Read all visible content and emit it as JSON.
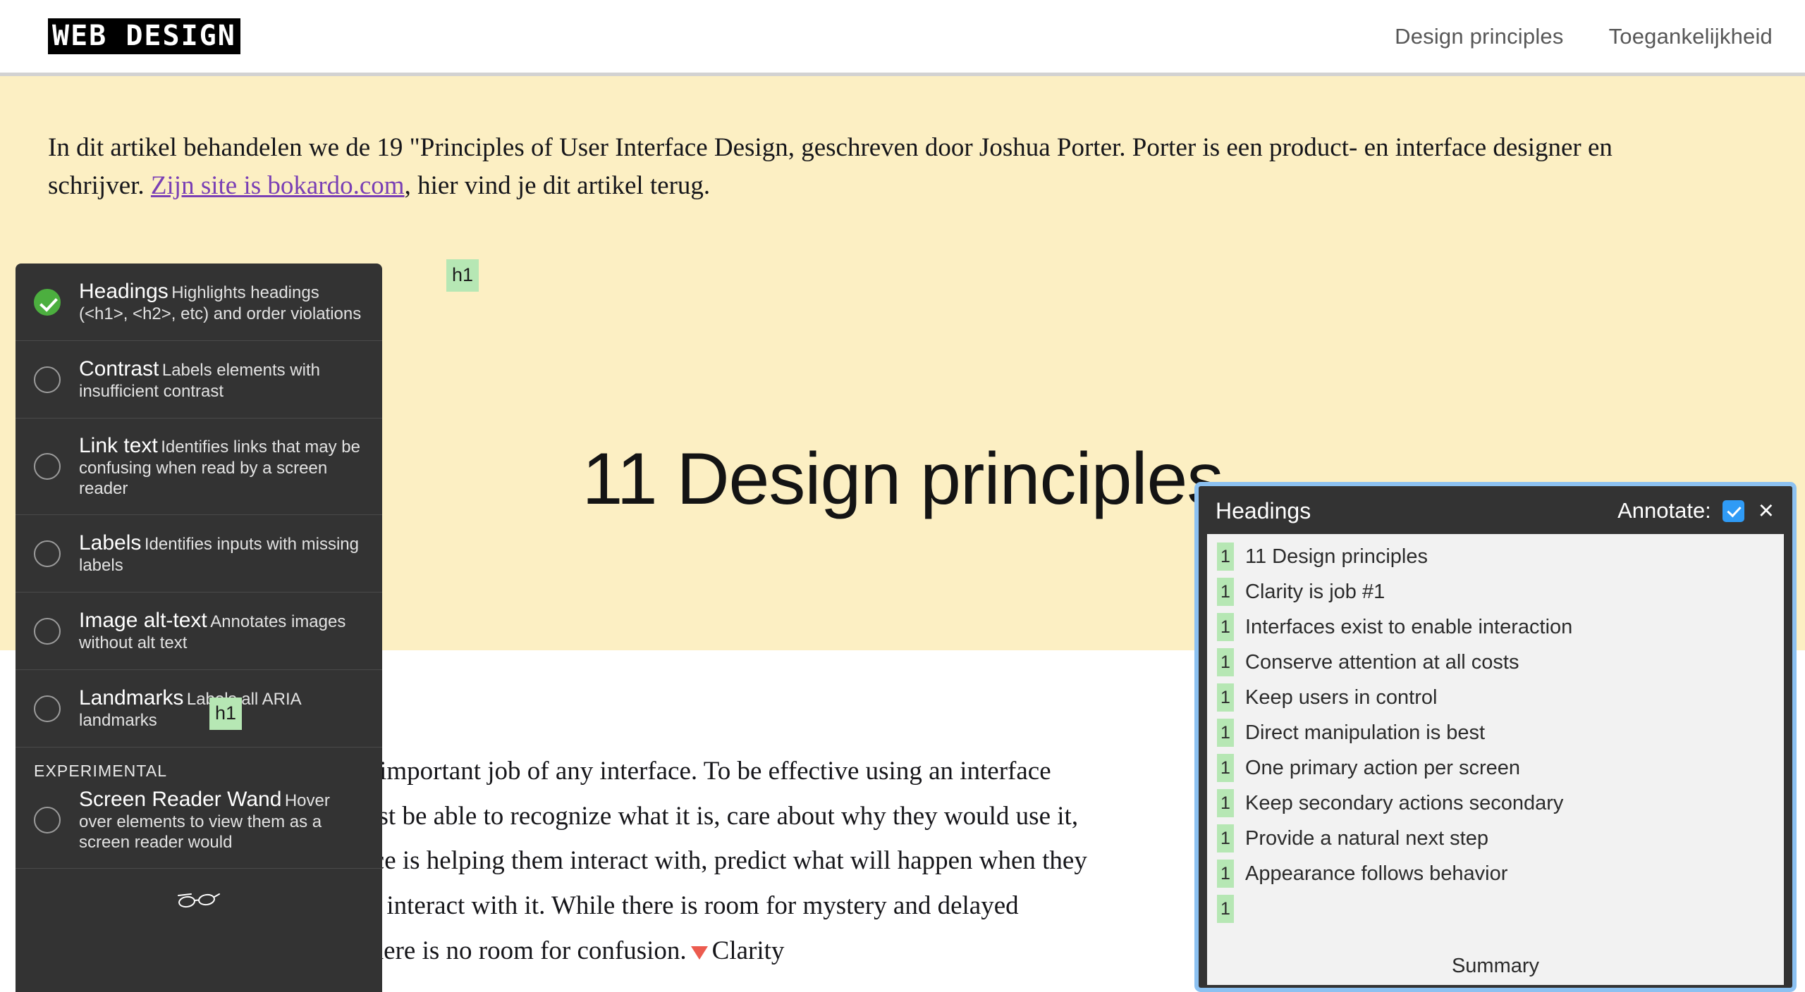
{
  "header": {
    "logo_text": "WEB DESIGN",
    "nav": [
      {
        "label": "Design principles"
      },
      {
        "label": "Toegankelijkheid"
      }
    ]
  },
  "hero": {
    "intro_before_link": "In dit artikel behandelen we de 19 \"Principles of User Interface Design, geschreven door Joshua Porter. Porter is een product- en interface designer en schrijver. ",
    "intro_link": "Zijn site is bokardo.com",
    "intro_after_link": ", hier vind je dit artikel terug.",
    "page_title": "11 Design principles",
    "badge_h1": "h1"
  },
  "content": {
    "sub_heading": "Clarity is job #1",
    "body_paragraph_a": "Clarity is the first and most important job of any interface. To be effective using an interface you've designed, people must be able to recognize what it is, care about why they would use it, understand what the interface is helping them interact with, predict what will happen when they use it, and then successfully interact with it. While there is room for mystery and delayed gratification in interfaces, there is no room for confusion.",
    "body_paragraph_b": "Clarity",
    "badge_h1": "h1"
  },
  "tool_panel": {
    "items": [
      {
        "title": "Headings",
        "desc": "Highlights headings (<h1>, <h2>, etc) and order violations",
        "enabled": true
      },
      {
        "title": "Contrast",
        "desc": "Labels elements with insufficient contrast",
        "enabled": false
      },
      {
        "title": "Link text",
        "desc": "Identifies links that may be confusing when read by a screen reader",
        "enabled": false
      },
      {
        "title": "Labels",
        "desc": "Identifies inputs with missing labels",
        "enabled": false
      },
      {
        "title": "Image alt-text",
        "desc": "Annotates images without alt text",
        "enabled": false
      },
      {
        "title": "Landmarks",
        "desc": "Labels all ARIA landmarks",
        "enabled": false
      }
    ],
    "experimental_label": "EXPERIMENTAL",
    "experimental_items": [
      {
        "title": "Screen Reader Wand",
        "desc": "Hover over elements to view them as a screen reader would",
        "enabled": false
      }
    ],
    "footer_icon": "glasses-icon"
  },
  "headings_panel": {
    "title": "Headings",
    "annotate_label": "Annotate:",
    "annotate_checked": true,
    "close_label": "×",
    "summary_label": "Summary",
    "items": [
      {
        "level": "1",
        "label": "11 Design principles"
      },
      {
        "level": "1",
        "label": "Clarity is job #1"
      },
      {
        "level": "1",
        "label": "Interfaces exist to enable interaction"
      },
      {
        "level": "1",
        "label": "Conserve attention at all costs"
      },
      {
        "level": "1",
        "label": "Keep users in control"
      },
      {
        "level": "1",
        "label": "Direct manipulation is best"
      },
      {
        "level": "1",
        "label": "One primary action per screen"
      },
      {
        "level": "1",
        "label": "Keep secondary actions secondary"
      },
      {
        "level": "1",
        "label": "Provide a natural next step"
      },
      {
        "level": "1",
        "label": "Appearance follows behavior"
      },
      {
        "level": "1",
        "label": ""
      }
    ]
  },
  "colors": {
    "hero_background": "#fcefc3",
    "panel_dark": "#333333",
    "accent_blue": "#8cc1f1",
    "checkbox_blue": "#2f9bf6",
    "badge_green": "#b6e7b4",
    "toggle_green": "#4caf3f",
    "link_purple": "#7a3fb5",
    "marker_red": "#ec5b4f"
  }
}
